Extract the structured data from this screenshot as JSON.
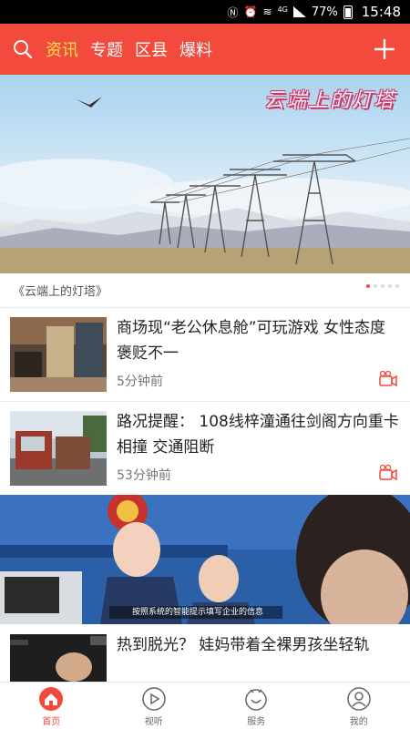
{
  "status_bar": {
    "battery": "77%",
    "time": "15:48",
    "net": "4G"
  },
  "header": {
    "tabs": [
      {
        "label": "资讯",
        "active": true
      },
      {
        "label": "专题",
        "active": false
      },
      {
        "label": "区县",
        "active": false
      },
      {
        "label": "爆料",
        "active": false
      }
    ],
    "accent_color": "#f24a3c",
    "active_tab_color": "#ffe44d"
  },
  "banner": {
    "overlay_title": "云端上的灯塔",
    "caption": "《云端上的灯塔》",
    "page_count": 5,
    "active_page": 1
  },
  "news": [
    {
      "title": "商场现“老公休息舱”可玩游戏 女性态度褒贬不一",
      "time": "5分钟前",
      "icon": "video-icon"
    },
    {
      "title": "路况提醒： 108线梓潼通往剑阁方向重卡相撞 交通阻断",
      "time": "53分钟前",
      "icon": "video-icon"
    }
  ],
  "big_card": {
    "subtitle": "按照系统的智能提示填写企业的信息"
  },
  "last_news": {
    "title": "热到脱光？ 娃妈带着全裸男孩坐轻轨"
  },
  "bottom_nav": [
    {
      "label": "首页",
      "icon": "home-icon",
      "active": true
    },
    {
      "label": "视听",
      "icon": "play-icon",
      "active": false
    },
    {
      "label": "服务",
      "icon": "service-icon",
      "active": false
    },
    {
      "label": "我的",
      "icon": "user-icon",
      "active": false
    }
  ]
}
